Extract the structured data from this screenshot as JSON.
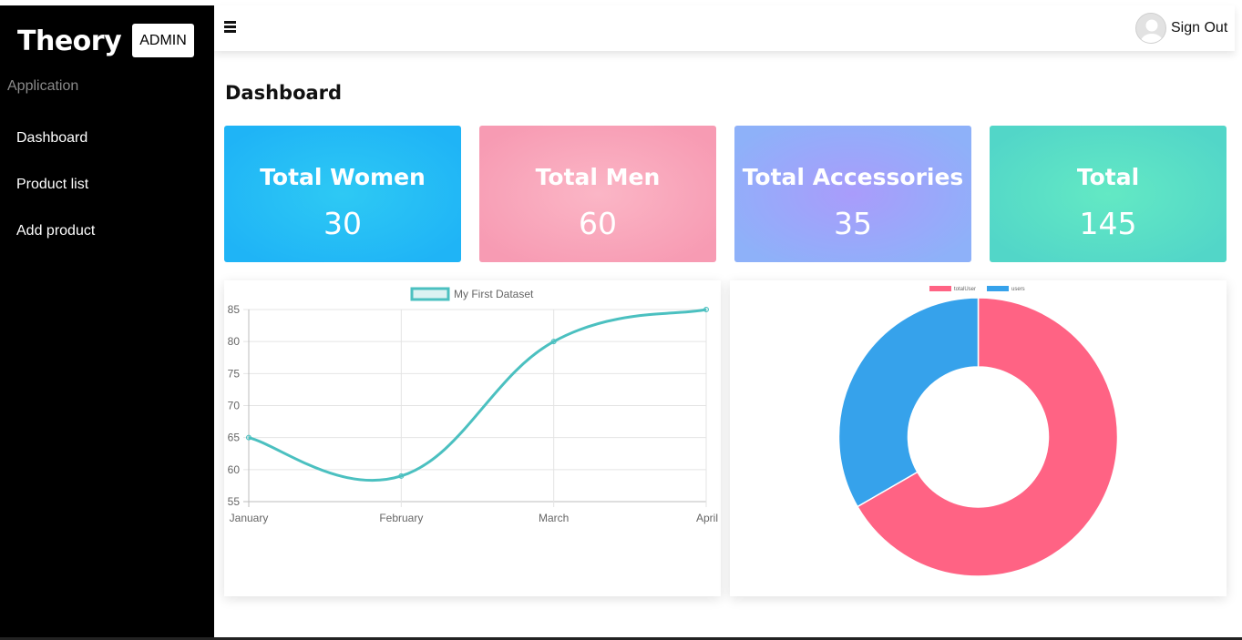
{
  "sidebar": {
    "brand": "Theory",
    "badge": "ADMIN",
    "section": "Application",
    "items": [
      {
        "label": "Dashboard"
      },
      {
        "label": "Product list"
      },
      {
        "label": "Add product"
      }
    ]
  },
  "topbar": {
    "menu_icon": "hamburger-menu-icon",
    "avatar_icon": "user-avatar-icon",
    "signout_label": "Sign Out"
  },
  "main": {
    "title": "Dashboard",
    "cards": [
      {
        "label": "Total Women",
        "value": "30",
        "colors": [
          "#2ec9f4",
          "#1fb4f6"
        ]
      },
      {
        "label": "Total Men",
        "value": "60",
        "colors": [
          "#fbb6c6",
          "#f79bb3"
        ]
      },
      {
        "label": "Total Accessories",
        "value": "35",
        "colors": [
          "#a99cfb",
          "#8eb1f9"
        ]
      },
      {
        "label": "Total",
        "value": "145",
        "colors": [
          "#63e9c4",
          "#52d6c8"
        ]
      }
    ]
  },
  "chart_data": [
    {
      "type": "line",
      "categories": [
        "January",
        "February",
        "March",
        "April"
      ],
      "series": [
        {
          "name": "My First Dataset",
          "values": [
            65,
            59,
            80,
            85
          ],
          "color": "#4bc0c0"
        }
      ],
      "ylim": [
        55,
        85
      ],
      "yticks": [
        55,
        60,
        65,
        70,
        75,
        80,
        85
      ],
      "grid": true,
      "legend": "top"
    },
    {
      "type": "pie",
      "variant": "doughnut",
      "labels": [
        "totalUser",
        "users"
      ],
      "values": [
        2,
        1
      ],
      "colors": [
        "#ff6384",
        "#36a2eb"
      ],
      "legend": "top"
    }
  ]
}
